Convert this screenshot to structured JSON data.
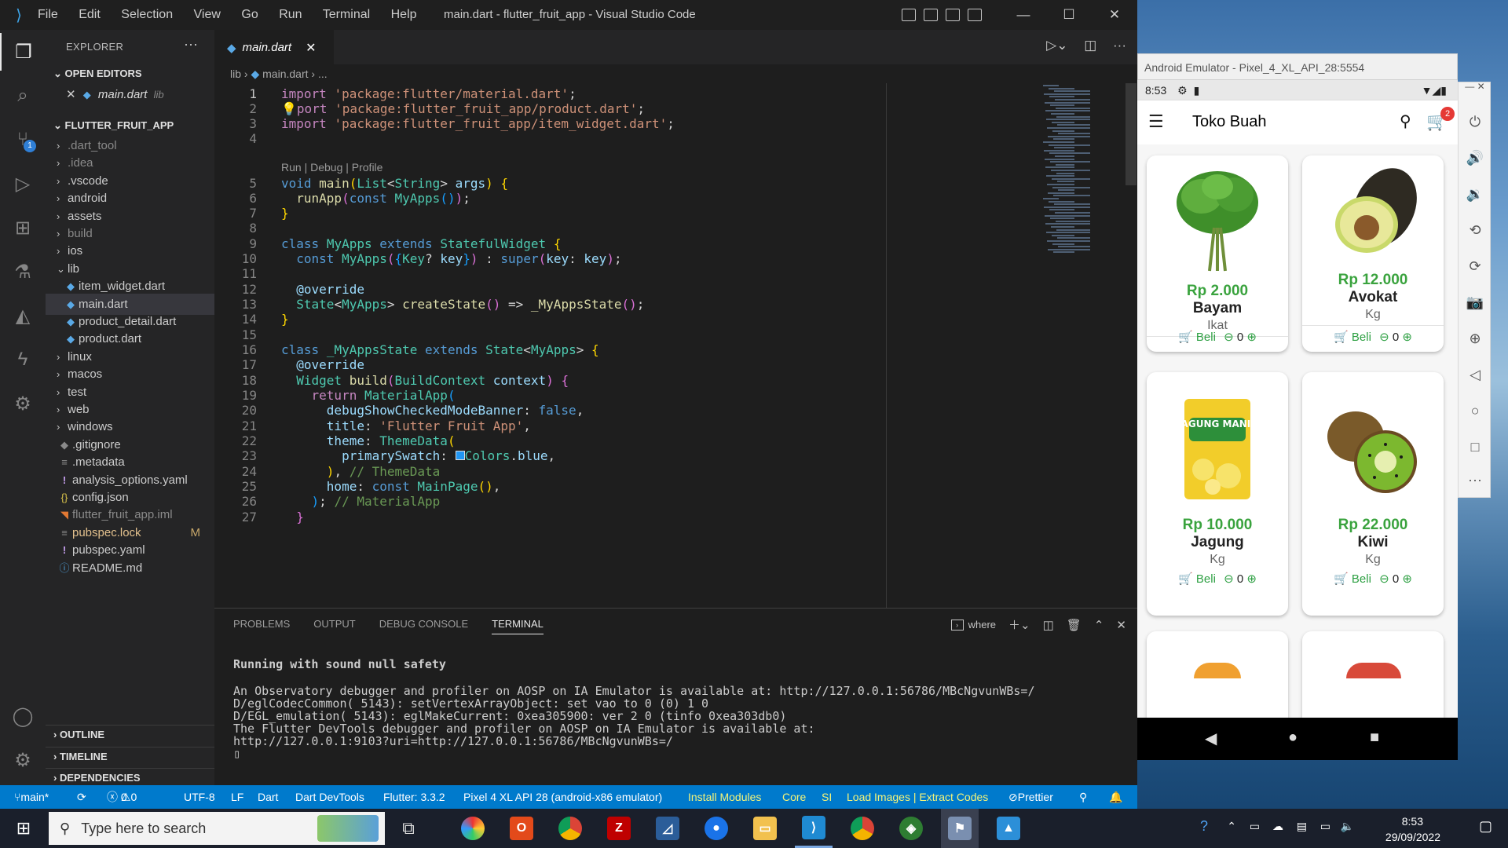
{
  "vscode": {
    "menu": [
      "File",
      "Edit",
      "Selection",
      "View",
      "Go",
      "Run",
      "Terminal",
      "Help"
    ],
    "window_title": "main.dart - flutter_fruit_app - Visual Studio Code",
    "source_control_badge": "1",
    "explorer": {
      "title": "EXPLORER",
      "open_editors_header": "OPEN EDITORS",
      "open_editor_file": "main.dart",
      "open_editor_path": "lib",
      "project_header": "FLUTTER_FRUIT_APP",
      "tree": [
        {
          "label": ".dart_tool",
          "kind": "folder",
          "muted": true
        },
        {
          "label": ".idea",
          "kind": "folder",
          "muted": true
        },
        {
          "label": ".vscode",
          "kind": "folder"
        },
        {
          "label": "android",
          "kind": "folder"
        },
        {
          "label": "assets",
          "kind": "folder"
        },
        {
          "label": "build",
          "kind": "folder",
          "muted": true
        },
        {
          "label": "ios",
          "kind": "folder"
        },
        {
          "label": "lib",
          "kind": "folder-open"
        },
        {
          "label": "item_widget.dart",
          "kind": "dart"
        },
        {
          "label": "main.dart",
          "kind": "dart",
          "selected": true
        },
        {
          "label": "product_detail.dart",
          "kind": "dart"
        },
        {
          "label": "product.dart",
          "kind": "dart"
        },
        {
          "label": "linux",
          "kind": "folder"
        },
        {
          "label": "macos",
          "kind": "folder"
        },
        {
          "label": "test",
          "kind": "folder"
        },
        {
          "label": "web",
          "kind": "folder"
        },
        {
          "label": "windows",
          "kind": "folder"
        },
        {
          "label": ".gitignore",
          "kind": "git"
        },
        {
          "label": ".metadata",
          "kind": "lines"
        },
        {
          "label": "analysis_options.yaml",
          "kind": "yaml"
        },
        {
          "label": "config.json",
          "kind": "json"
        },
        {
          "label": "flutter_fruit_app.iml",
          "kind": "rss",
          "muted": true
        },
        {
          "label": "pubspec.lock",
          "kind": "lines",
          "status": "M"
        },
        {
          "label": "pubspec.yaml",
          "kind": "yaml"
        },
        {
          "label": "README.md",
          "kind": "info"
        }
      ],
      "bottom_sections": [
        "OUTLINE",
        "TIMELINE",
        "DEPENDENCIES"
      ]
    },
    "tab_label": "main.dart",
    "breadcrumb": [
      "lib",
      "main.dart",
      "..."
    ],
    "codelens": "Run | Debug | Profile",
    "line_numbers": [
      "1",
      "2",
      "3",
      "4",
      "5",
      "6",
      "7",
      "8",
      "9",
      "10",
      "11",
      "12",
      "13",
      "14",
      "15",
      "16",
      "17",
      "18",
      "19",
      "20",
      "21",
      "22",
      "23",
      "24",
      "25",
      "26",
      "27"
    ],
    "panel": {
      "tabs": [
        "PROBLEMS",
        "OUTPUT",
        "DEBUG CONSOLE",
        "TERMINAL"
      ],
      "active_tab": "TERMINAL",
      "terminal_name": "where",
      "terminal_lines": [
        "Running with sound null safety",
        "An Observatory debugger and profiler on AOSP on IA Emulator is available at: http://127.0.0.1:56786/MBcNgvunWBs=/",
        "D/eglCodecCommon( 5143): setVertexArrayObject: set vao to 0 (0) 1 0",
        "D/EGL_emulation( 5143): eglMakeCurrent: 0xea305900: ver 2 0 (tinfo 0xea303db0)",
        "The Flutter DevTools debugger and profiler on AOSP on IA Emulator is available at:",
        "http://127.0.0.1:9103?uri=http://127.0.0.1:56786/MBcNgvunWBs=/"
      ]
    },
    "statusbar": {
      "branch": "main*",
      "problems": "0",
      "warnings": "0",
      "encoding": "UTF-8",
      "eol": "LF",
      "language": "Dart",
      "devtools": "Dart DevTools",
      "flutter": "Flutter: 3.3.2",
      "device": "Pixel 4 XL API 28 (android-x86 emulator)",
      "install_modules": "Install Modules",
      "core": "Core",
      "si": "SI",
      "load_images": "Load Images | Extract Codes",
      "prettier": "Prettier"
    }
  },
  "emulator": {
    "window_title": "Android Emulator - Pixel_4_XL_API_28:5554",
    "clock": "8:53",
    "app_title": "Toko Buah",
    "cart_count": "2",
    "products": [
      {
        "price": "Rp 2.000",
        "name": "Bayam",
        "unit": "Ikat",
        "buy": "Beli",
        "qty": "0"
      },
      {
        "price": "Rp 12.000",
        "name": "Avokat",
        "unit": "Kg",
        "buy": "Beli",
        "qty": "0"
      },
      {
        "price": "Rp 10.000",
        "name": "Jagung",
        "unit": "Kg",
        "buy": "Beli",
        "qty": "0",
        "package_text": "JAGUNG MANIS"
      },
      {
        "price": "Rp 22.000",
        "name": "Kiwi",
        "unit": "Kg",
        "buy": "Beli",
        "qty": "0"
      }
    ]
  },
  "taskbar": {
    "search_placeholder": "Type here to search",
    "time": "8:53",
    "date": "29/09/2022"
  }
}
